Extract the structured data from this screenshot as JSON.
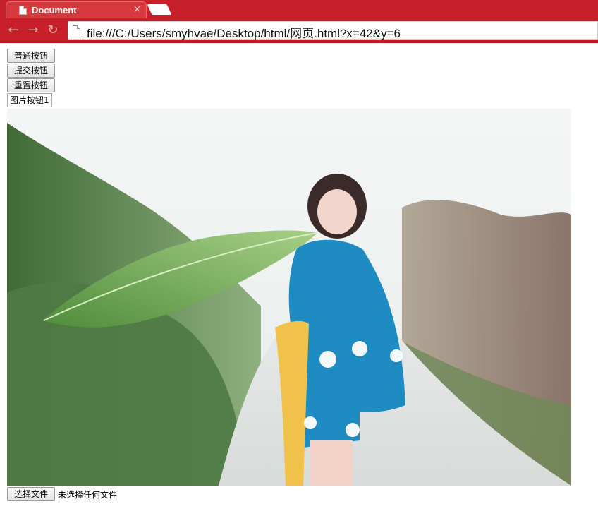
{
  "browser": {
    "tab_title": "Document",
    "tab_close": "×",
    "url": "file:///C:/Users/smyhvae/Desktop/html/网页.html?x=42&y=6",
    "accent": "#c8202a"
  },
  "page": {
    "buttons": [
      "普通按钮",
      "提交按钮",
      "重置按钮"
    ],
    "image_button_label": "图片按钮1",
    "file_input": {
      "button_label": "选择文件",
      "status": "未选择任何文件"
    }
  }
}
